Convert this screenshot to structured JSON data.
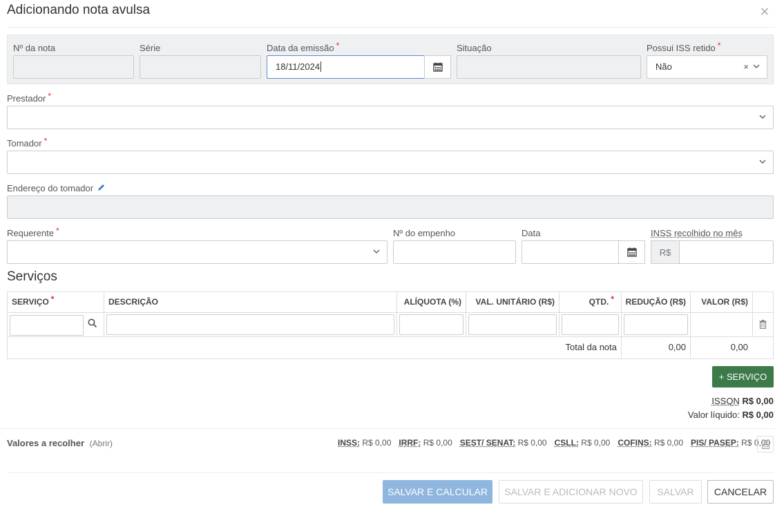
{
  "modal": {
    "title": "Adicionando nota avulsa",
    "close_icon": "×"
  },
  "header_fields": {
    "numero_label": "Nº da nota",
    "serie_label": "Série",
    "data_emissao_label": "Data da emissão",
    "data_emissao_value": "18/11/2024",
    "situacao_label": "Situação",
    "iss_label": "Possui ISS retido",
    "iss_value": "Não"
  },
  "prestador": {
    "label": "Prestador",
    "value": ""
  },
  "tomador": {
    "label": "Tomador",
    "value": ""
  },
  "endereco_tomador": {
    "label": "Endereço do tomador"
  },
  "requerente": {
    "label": "Requerente",
    "value": ""
  },
  "empenho": {
    "label": "Nº do empenho",
    "value": ""
  },
  "data": {
    "label": "Data",
    "value": ""
  },
  "inss_mes": {
    "label": "INSS recolhido no mês",
    "prefix": "R$",
    "value": ""
  },
  "servicos": {
    "title": "Serviços",
    "columns": [
      "SERVIÇO",
      "DESCRIÇÃO",
      "ALÍQUOTA (%)",
      "VAL. UNITÁRIO (R$)",
      "QTD.",
      "REDUÇÃO (R$)",
      "VALOR (R$)"
    ],
    "total_label": "Total da nota",
    "total_reducao": "0,00",
    "total_valor": "0,00",
    "add_button": "+ SERVIÇO"
  },
  "summary": {
    "issqn_label": "ISSQN",
    "issqn_value": "R$ 0,00",
    "liquido_label": "Valor líquido:",
    "liquido_value": "R$ 0,00"
  },
  "valores_recolher": {
    "label": "Valores a recolher",
    "toggle": "(Abrir)",
    "taxes": [
      {
        "name": "INSS:",
        "value": "R$ 0,00"
      },
      {
        "name": "IRRF:",
        "value": "R$ 0,00"
      },
      {
        "name": "SEST/ SENAT:",
        "value": "R$ 0,00"
      },
      {
        "name": "CSLL:",
        "value": "R$ 0,00"
      },
      {
        "name": "COFINS:",
        "value": "R$ 0,00"
      },
      {
        "name": "PIS/ PASEP:",
        "value": "R$ 0,00"
      }
    ]
  },
  "footer": {
    "salvar_calcular": "SALVAR E CALCULAR",
    "salvar_adicionar": "SALVAR E ADICIONAR NOVO",
    "salvar": "SALVAR",
    "cancelar": "CANCELAR"
  }
}
